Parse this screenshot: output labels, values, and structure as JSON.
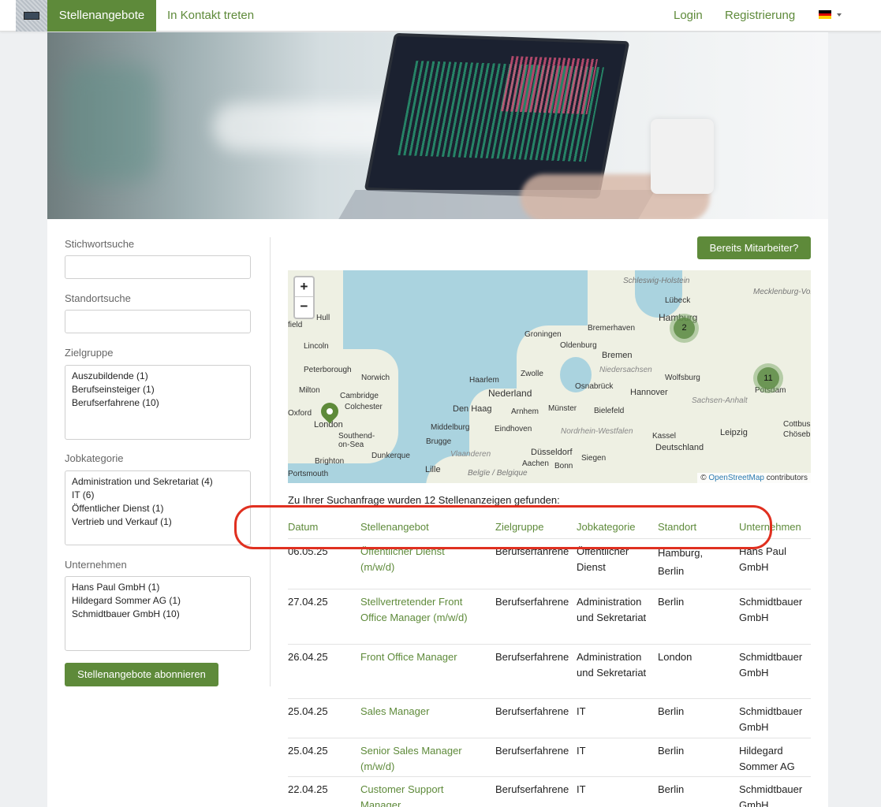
{
  "nav": {
    "active": "Stellenangebote",
    "contact": "In Kontakt treten",
    "login": "Login",
    "register": "Registrierung"
  },
  "sidebar": {
    "keyword_label": "Stichwortsuche",
    "location_label": "Standortsuche",
    "target_label": "Zielgruppe",
    "target_items": [
      "Auszubildende (1)",
      "Berufseinsteiger (1)",
      "Berufserfahrene (10)"
    ],
    "category_label": "Jobkategorie",
    "category_items": [
      "Administration und Sekretariat (4)",
      "IT (6)",
      "Öffentlicher Dienst (1)",
      "Vertrieb und Verkauf (1)"
    ],
    "company_label": "Unternehmen",
    "company_items": [
      "Hans Paul GmbH (1)",
      "Hildegard Sommer AG (1)",
      "Schmidtbauer GmbH (10)"
    ],
    "subscribe_button": "Stellenangebote abonnieren"
  },
  "employee_button": "Bereits Mitarbeiter?",
  "map": {
    "zoom_in": "+",
    "zoom_out": "−",
    "cluster_hamburg": "2",
    "cluster_berlin": "11",
    "attribution_prefix": "©",
    "attribution_link": "OpenStreetMap",
    "attribution_suffix": "contributors",
    "labels": [
      "Schleswig-Holstein",
      "Mecklenburg-Vorpommern",
      "Lübeck",
      "Hamburg",
      "Bremerhaven",
      "Groningen",
      "Oldenburg",
      "Bremen",
      "Niedersachsen",
      "Zwolle",
      "Osnabrück",
      "Hannover",
      "Wolfsburg",
      "Nederland",
      "Haarlem",
      "Den Haag",
      "Arnhem",
      "Münster",
      "Bielefeld",
      "Sachsen-Anhalt",
      "Potsdam",
      "Middelburg",
      "Eindhoven",
      "Nordrhein-Westfalen",
      "Kassel",
      "Leipzig",
      "Cottbus",
      "Brugge",
      "Düsseldorf",
      "Siegen",
      "Deutschland",
      "Vlaanderen",
      "Aachen",
      "Bonn",
      "Lille",
      "Belgïe / Belgique",
      "Lincoln",
      "Peterborough",
      "Norwich",
      "Milton",
      "Cambridge",
      "Colchester",
      "Oxford",
      "London",
      "Southend-on-Sea",
      "Brighton",
      "Dunkerque",
      "Portsmouth",
      "Hull",
      "field",
      "Chösebu"
    ]
  },
  "result_text": "Zu Ihrer Suchanfrage wurden 12 Stellenanzeigen gefunden:",
  "table": {
    "headers": [
      "Datum",
      "Stellenangebot",
      "Zielgruppe",
      "Jobkategorie",
      "Standort",
      "Unternehmen"
    ],
    "rows": [
      {
        "date": "06.05.25",
        "title": "Öffentlicher Dienst (m/w/d)",
        "target": "Berufserfahrene",
        "category": "Öffentlicher Dienst",
        "location": "Hamburg, Berlin",
        "company": "Hans Paul GmbH"
      },
      {
        "date": "27.04.25",
        "title": "Stellvertretender Front Office Manager (m/w/d)",
        "target": "Berufserfahrene",
        "category": "Administration und Sekretariat",
        "location": "Berlin",
        "company": "Schmidtbauer GmbH"
      },
      {
        "date": "26.04.25",
        "title": "Front Office Manager",
        "target": "Berufserfahrene",
        "category": "Administration und Sekretariat",
        "location": "London",
        "company": "Schmidtbauer GmbH"
      },
      {
        "date": "25.04.25",
        "title": "Sales Manager",
        "target": "Berufserfahrene",
        "category": "IT",
        "location": "Berlin",
        "company": "Schmidtbauer GmbH"
      },
      {
        "date": "25.04.25",
        "title": "Senior Sales Manager (m/w/d)",
        "target": "Berufserfahrene",
        "category": "IT",
        "location": "Berlin",
        "company": "Hildegard Sommer AG"
      },
      {
        "date": "22.04.25",
        "title": "Customer Support Manager",
        "target": "Berufserfahrene",
        "category": "IT",
        "location": "Berlin",
        "company": "Schmidtbauer GmbH"
      }
    ]
  },
  "colors": {
    "accent": "#5e8a3a",
    "highlight": "#e03020",
    "water": "#aad3df"
  }
}
